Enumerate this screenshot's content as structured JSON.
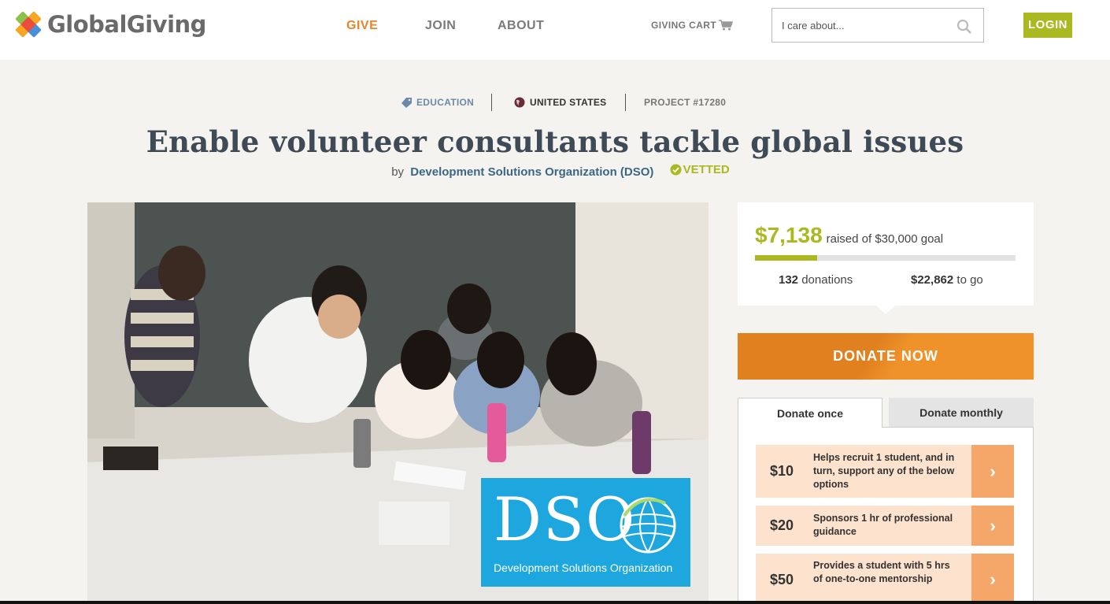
{
  "header": {
    "brand": "GlobalGiving",
    "nav": {
      "give": "GIVE",
      "join": "JOIN",
      "about": "ABOUT"
    },
    "cart_label": "GIVING CART",
    "search_placeholder": "I care about...",
    "login_label": "LOGIN"
  },
  "meta": {
    "category": "EDUCATION",
    "country": "UNITED STATES",
    "project": "PROJECT #17280"
  },
  "project": {
    "title": "Enable volunteer consultants tackle global issues",
    "by_label": "by",
    "organization": "Development Solutions Organization (DSO)",
    "vetted_label": "VETTED"
  },
  "photo": {
    "logo_text": "DSO",
    "logo_subtitle": "Development Solutions Organization"
  },
  "funding": {
    "raised": "$7,138",
    "raised_label": "raised of $30,000 goal",
    "progress_fraction": 0.238,
    "donations_count": "132",
    "donations_label": "donations",
    "remaining": "$22,862",
    "remaining_label": "to go"
  },
  "donate": {
    "cta": "DONATE NOW",
    "tabs": {
      "once": "Donate once",
      "monthly": "Donate monthly"
    },
    "options": [
      {
        "amount": "$10",
        "description": "Helps recruit 1 student, and in turn, support any of the below options"
      },
      {
        "amount": "$20",
        "description": "Sponsors 1 hr of professional guidance"
      },
      {
        "amount": "$50",
        "description": "Provides a student with 5 hrs of one-to-one mentorship"
      }
    ],
    "arrow": "›"
  },
  "colors": {
    "accent_green": "#a9b91f",
    "accent_orange": "#e6862c",
    "title_color": "#3f4a57",
    "option_bg": "#fde2cd",
    "option_arrow_bg": "#f4a768",
    "dso_blue": "#1ea7de"
  },
  "icons": {
    "category": "tag-icon",
    "country": "globe-icon",
    "vetted": "check-circle-icon",
    "cart": "cart-icon",
    "search": "search-icon"
  }
}
